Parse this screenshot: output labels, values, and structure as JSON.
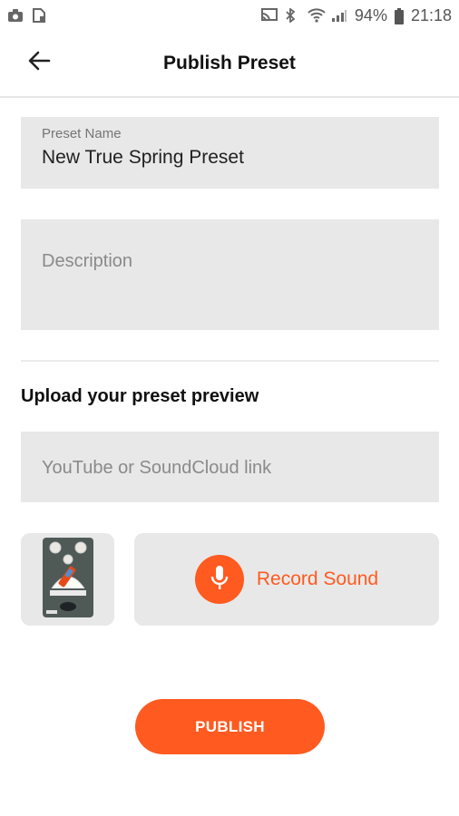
{
  "status_bar": {
    "battery": "94%",
    "time": "21:18",
    "icons": [
      "camera-icon",
      "sim-icon",
      "cast-icon",
      "bluetooth-icon",
      "wifi-icon",
      "signal-icon",
      "battery-icon"
    ]
  },
  "appbar": {
    "title": "Publish Preset",
    "back_icon": "arrow-left-icon"
  },
  "form": {
    "preset_name_label": "Preset Name",
    "preset_name_value": "New True Spring Preset",
    "description_placeholder": "Description",
    "upload_title": "Upload your preset preview",
    "link_placeholder": "YouTube or SoundCloud link"
  },
  "record": {
    "label": "Record Sound",
    "icon": "microphone-icon"
  },
  "publish": {
    "label": "PUBLISH"
  },
  "colors": {
    "accent": "#ff5a1f",
    "field_bg": "#e8e8e8"
  }
}
